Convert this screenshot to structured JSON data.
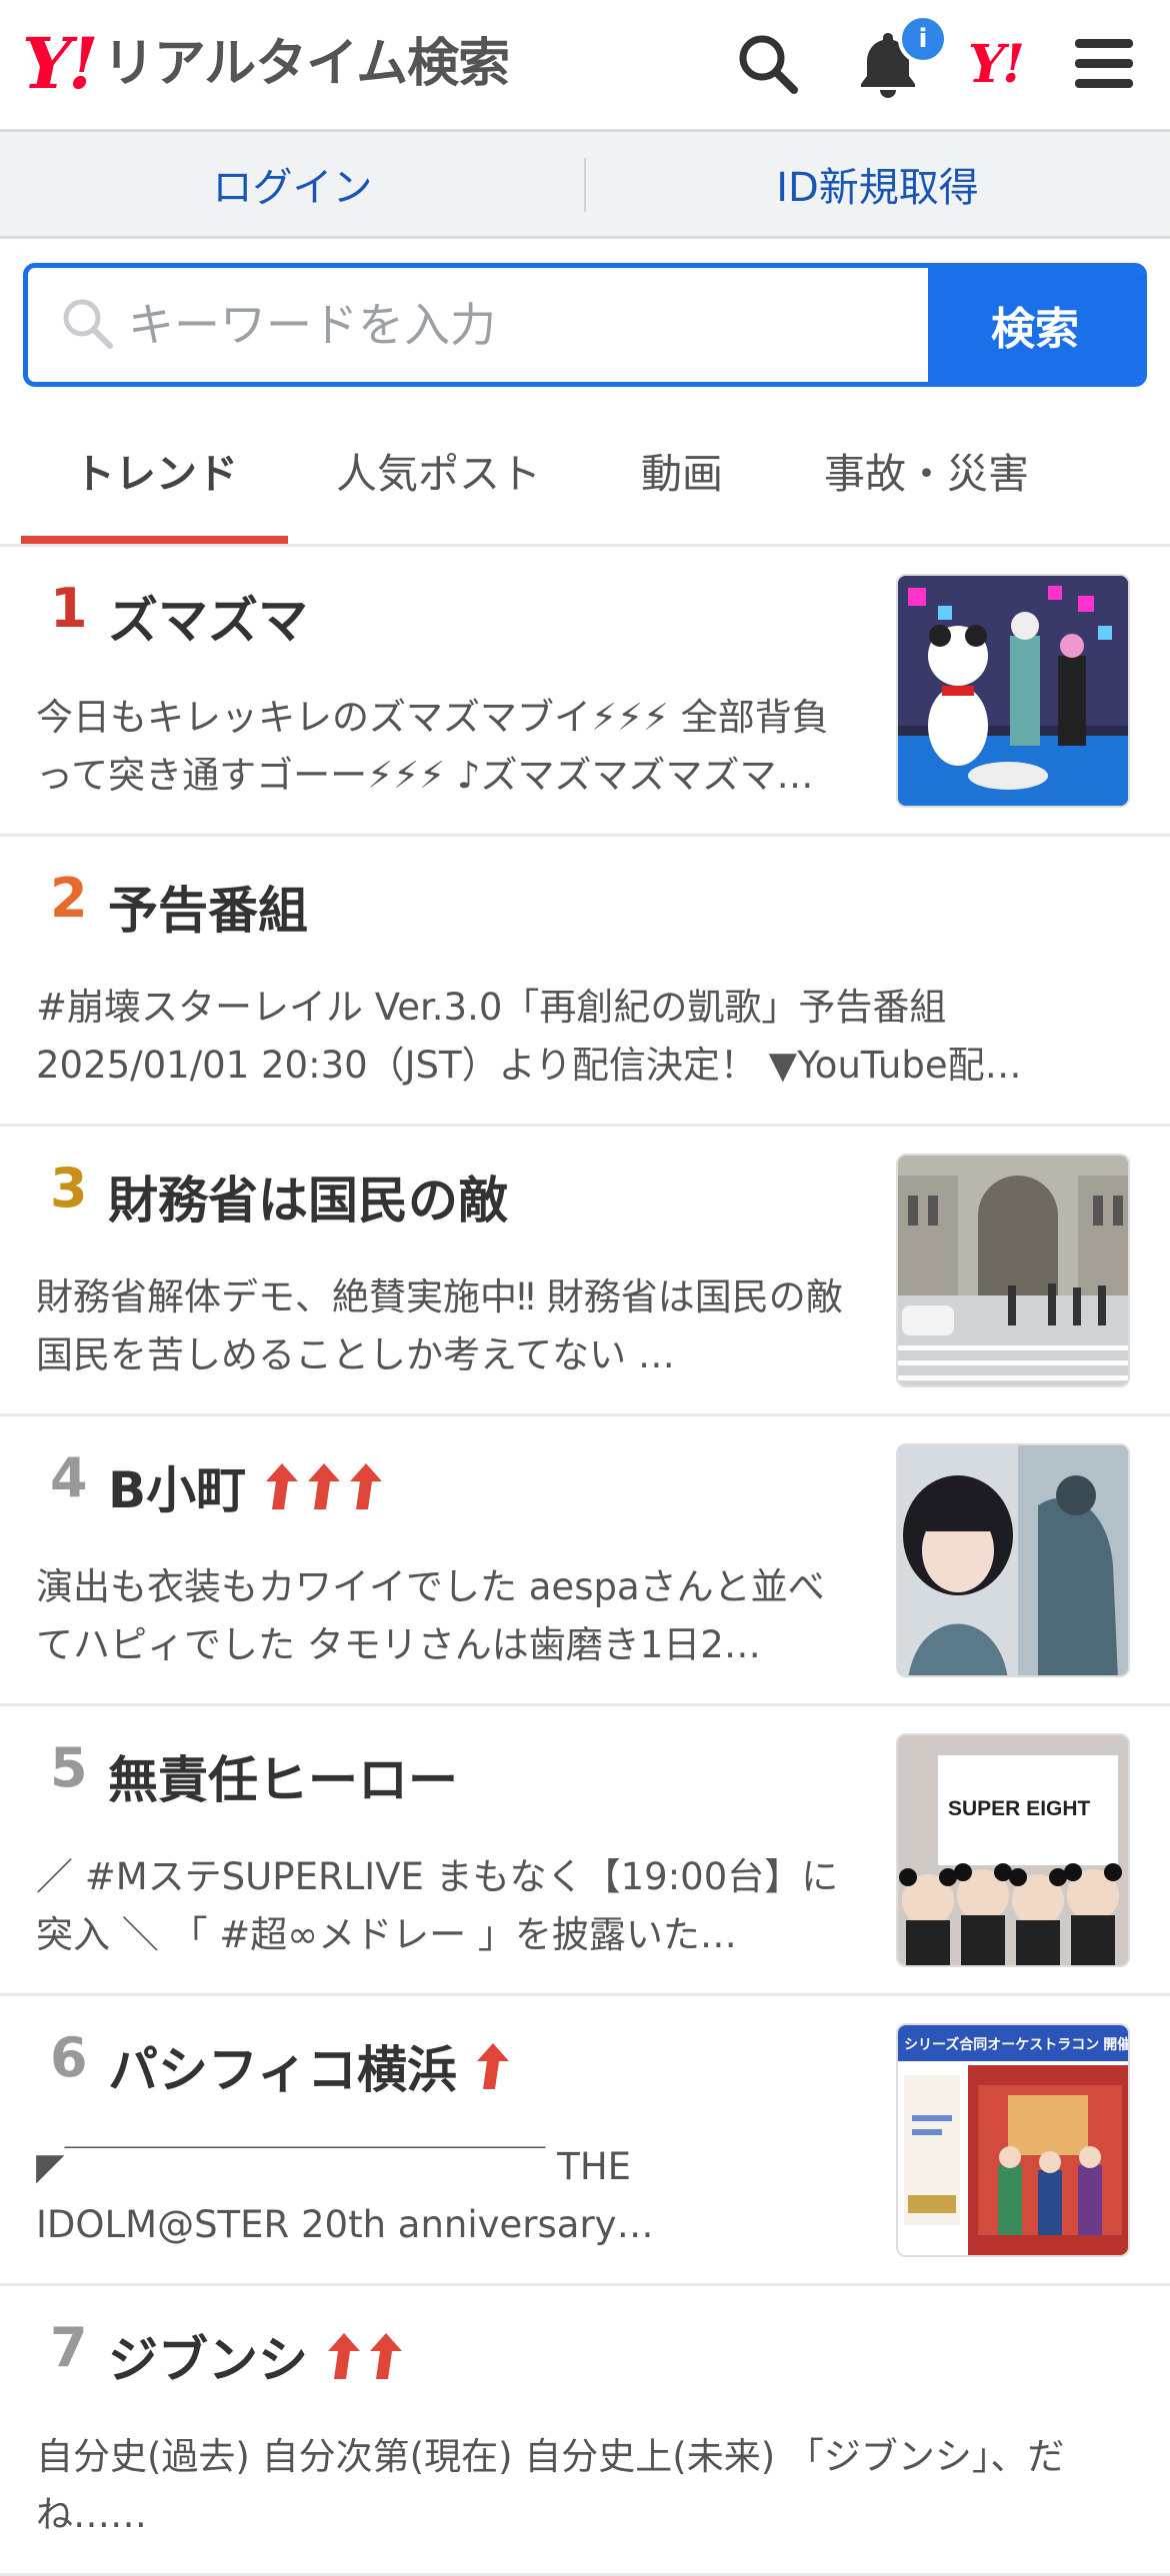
{
  "header": {
    "logo_mark": "Y!",
    "logo_text": "リアルタイム検索",
    "notification_badge": "i",
    "yahoo_mark": "Y!",
    "icons": [
      "search-icon",
      "bell-icon",
      "yahoo-icon",
      "menu-icon"
    ]
  },
  "login_bar": {
    "login": "ログイン",
    "signup": "ID新規取得"
  },
  "search": {
    "placeholder": "キーワードを入力",
    "button": "検索"
  },
  "tabs": [
    {
      "label": "トレンド",
      "active": true
    },
    {
      "label": "人気ポスト",
      "active": false
    },
    {
      "label": "動画",
      "active": false
    },
    {
      "label": "事故・災害",
      "active": false
    }
  ],
  "colors": {
    "brand_red": "#ff0033",
    "link_blue": "#1856b8",
    "search_blue": "#1b6fe8",
    "badge_blue": "#2f86e8",
    "rank1": "#d0362c",
    "rank2": "#e56a2c",
    "rank3": "#c89017",
    "rank_other": "#999999",
    "arrow_red": "#e0453a"
  },
  "trends": [
    {
      "rank": "1",
      "title": "ズマズマ",
      "arrows": 0,
      "desc": "今日もキレッキレのズマズマブイ⚡⚡⚡ 全部背負って突き通すゴーー⚡⚡⚡ ♪ズマズマズマズマ…",
      "has_thumb": true
    },
    {
      "rank": "2",
      "title": "予告番組",
      "arrows": 0,
      "desc": "#崩壊スターレイル Ver.3.0「再創紀の凱歌」予告番組 2025/01/01 20:30（JST）より配信決定！ ▼YouTube配…",
      "has_thumb": false
    },
    {
      "rank": "3",
      "title": "財務省は国民の敵",
      "arrows": 0,
      "desc": "財務省解体デモ、絶賛実施中‼ 財務省は国民の敵 国民を苦しめることしか考えてない  …",
      "has_thumb": true
    },
    {
      "rank": "4",
      "title": "B小町",
      "arrows": 3,
      "desc": "演出も衣装もカワイイでした aespaさんと並べてハピィでした タモリさんは歯磨き1日2…",
      "has_thumb": true
    },
    {
      "rank": "5",
      "title": "無責任ヒーロー",
      "arrows": 0,
      "desc": "／ #MステSUPERLIVE まもなく【19:00台】に突入 ＼ 「 #超∞メドレー 」を披露いた…",
      "has_thumb": true,
      "thumb_caption": "SUPER EIGHT"
    },
    {
      "rank": "6",
      "title": "パシフィコ横浜",
      "arrows": 1,
      "desc": "◤￣￣￣￣￣￣￣￣￣￣￣￣￣ THE IDOLM@STER 20th anniversary…",
      "has_thumb": true,
      "thumb_caption": "シリーズ合同オーケストラコン 開催決定!!"
    },
    {
      "rank": "7",
      "title": "ジブンシ",
      "arrows": 2,
      "desc": "自分史(過去) 自分次第(現在) 自分史上(未来) 「ジブンシ」、だね……",
      "has_thumb": false
    }
  ]
}
